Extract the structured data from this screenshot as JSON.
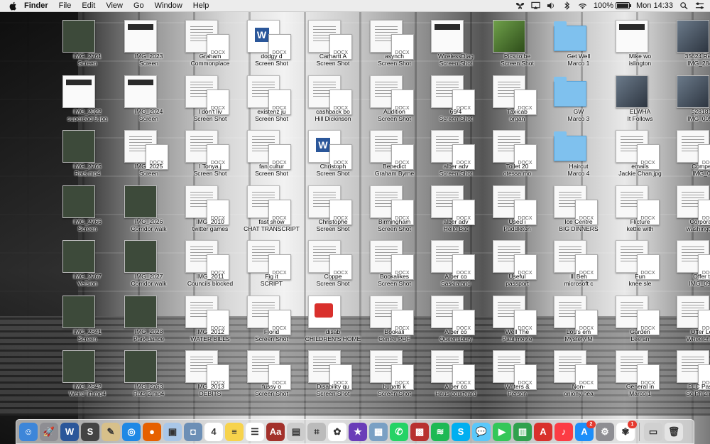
{
  "menubar": {
    "app_name": "Finder",
    "menus": [
      "File",
      "Edit",
      "View",
      "Go",
      "Window",
      "Help"
    ],
    "battery_percent": "100%",
    "battery_level": 1.0,
    "clock": "Mon 14:33"
  },
  "colors": {
    "menubar_bg": "#ececec",
    "folder_blue": "#7fc1ee",
    "word_blue": "#2b579a",
    "badge_red": "#e53b30"
  },
  "desktop": {
    "docx_tag": "DOCX",
    "icons": [
      {
        "kind": "video",
        "lines": [
          "IMG_2761",
          "Screen"
        ]
      },
      {
        "kind": "screenshot",
        "lines": [
          "IMG_2023",
          "Screen"
        ]
      },
      {
        "kind": "doc",
        "lines": [
          "Graham",
          "Commonplace"
        ]
      },
      {
        "kind": "word",
        "lines": [
          "dodgy d",
          "Screen Shot"
        ]
      },
      {
        "kind": "doc",
        "lines": [
          "Carhartt A",
          "Screen Shot"
        ]
      },
      {
        "kind": "doc",
        "lines": [
          "asynch",
          "Screen Shot"
        ]
      },
      {
        "kind": "screenshot",
        "lines": [
          "WirelessDiag",
          "Screen Shot"
        ]
      },
      {
        "kind": "green",
        "lines": [
          "Pics to be",
          "Screen Shot"
        ]
      },
      {
        "kind": "folder",
        "lines": [
          "Get Well",
          "Marco 1"
        ]
      },
      {
        "kind": "screenshot",
        "lines": [
          "Mike wo",
          "islington"
        ]
      },
      {
        "kind": "photo",
        "lines": [
          "35624 RevV",
          "IMG_2843"
        ]
      },
      {
        "kind": "screenshot",
        "lines": [
          "IMG_2022",
          "superbad 5.jpg"
        ]
      },
      {
        "kind": "screenshot",
        "lines": [
          "IMG_2024",
          "Screen"
        ]
      },
      {
        "kind": "doc",
        "lines": [
          "I don't liv",
          "Screen Shot"
        ]
      },
      {
        "kind": "doc",
        "lines": [
          "existenz ju",
          "Screen Shot"
        ]
      },
      {
        "kind": "doc",
        "lines": [
          "cashback bo",
          "Hill Dickinson"
        ]
      },
      {
        "kind": "doc",
        "lines": [
          "Audition",
          "Screen Shot"
        ]
      },
      {
        "kind": "doc",
        "lines": [
          "69/4",
          "Screen Shot"
        ]
      },
      {
        "kind": "doc",
        "lines": [
          "Taxicab",
          "organ"
        ]
      },
      {
        "kind": "folder",
        "lines": [
          "GW",
          "Marco 3"
        ]
      },
      {
        "kind": "photo",
        "lines": [
          "ELWHA",
          "It Follows"
        ]
      },
      {
        "kind": "photo",
        "lines": [
          "528181",
          "IMG_0951"
        ]
      },
      {
        "kind": "video",
        "lines": [
          "IMG_2765",
          "Rats.mp4"
        ]
      },
      {
        "kind": "doc",
        "lines": [
          "IMG_2025",
          "Screen"
        ]
      },
      {
        "kind": "doc",
        "lines": [
          "I Tonya.j",
          "Screen Shot"
        ]
      },
      {
        "kind": "doc",
        "lines": [
          "fan cultur",
          "Screen Shot"
        ]
      },
      {
        "kind": "word",
        "lines": [
          "Christoph",
          "Screen Shot"
        ]
      },
      {
        "kind": "doc",
        "lines": [
          "Benedict",
          "Graham Byrne"
        ]
      },
      {
        "kind": "doc",
        "lines": [
          "alber adv",
          "Screen Shot"
        ]
      },
      {
        "kind": "doc",
        "lines": [
          "Toilet 20",
          "otessa mo"
        ]
      },
      {
        "kind": "folder",
        "lines": [
          "Haircut",
          "Marco 4"
        ]
      },
      {
        "kind": "doc",
        "lines": [
          "emails",
          "Jackie Chan.jpg"
        ]
      },
      {
        "kind": "doc",
        "lines": [
          "Compe",
          "IMG_0"
        ]
      },
      {
        "kind": "video",
        "lines": [
          "IMG_2766",
          "Screen"
        ]
      },
      {
        "kind": "video",
        "lines": [
          "IMG_2026",
          "Corridor walk"
        ]
      },
      {
        "kind": "doc",
        "lines": [
          "IMG_2010",
          "twitter games"
        ]
      },
      {
        "kind": "doc",
        "lines": [
          "fast show",
          "CHAT TRANSCRIPT"
        ]
      },
      {
        "kind": "doc",
        "lines": [
          "Christophe",
          "Screen Shot"
        ]
      },
      {
        "kind": "doc",
        "lines": [
          "Birmingham",
          "Screen Shot"
        ]
      },
      {
        "kind": "doc",
        "lines": [
          "alber adv",
          "Hello Bat"
        ]
      },
      {
        "kind": "doc",
        "lines": [
          "Used i",
          "Paddleton"
        ]
      },
      {
        "kind": "doc",
        "lines": [
          "Ice Centre",
          "BIG DINNERS"
        ]
      },
      {
        "kind": "doc",
        "lines": [
          "Flicture",
          "kettle with"
        ]
      },
      {
        "kind": "doc",
        "lines": [
          "Corporat",
          "washington"
        ]
      },
      {
        "kind": "video",
        "lines": [
          "IMG_2767",
          "Version"
        ]
      },
      {
        "kind": "video",
        "lines": [
          "IMG_2027",
          "Corridor walk"
        ]
      },
      {
        "kind": "doc",
        "lines": [
          "IMG_2011",
          "Councils blocked"
        ]
      },
      {
        "kind": "doc",
        "lines": [
          "Fig it",
          "SCRIPT"
        ]
      },
      {
        "kind": "doc",
        "lines": [
          "Coppe",
          "Screen Shot"
        ]
      },
      {
        "kind": "doc",
        "lines": [
          "Bookalikes",
          "Screen Shot"
        ]
      },
      {
        "kind": "doc",
        "lines": [
          "Alber co",
          "Saskia and"
        ]
      },
      {
        "kind": "doc",
        "lines": [
          "Useful",
          "passport"
        ]
      },
      {
        "kind": "doc",
        "lines": [
          "Ill Beh",
          "microsoft c"
        ]
      },
      {
        "kind": "doc",
        "lines": [
          "Fun",
          "knee sle"
        ]
      },
      {
        "kind": "doc",
        "lines": [
          "Offer t",
          "IMG_095"
        ]
      },
      {
        "kind": "video",
        "lines": [
          "IMG_2841",
          "Screen"
        ]
      },
      {
        "kind": "video",
        "lines": [
          "IMG_2028",
          "Park dance"
        ]
      },
      {
        "kind": "doc",
        "lines": [
          "IMG_2012",
          "WATER BILLS"
        ]
      },
      {
        "kind": "doc",
        "lines": [
          "Florid",
          "Screen Shot"
        ]
      },
      {
        "kind": "pdf",
        "lines": [
          "disab",
          "CHILDREN'S HOME"
        ]
      },
      {
        "kind": "doc",
        "lines": [
          "Bookali",
          "Centre PDF"
        ]
      },
      {
        "kind": "doc",
        "lines": [
          "Alber co",
          "Queensbury"
        ]
      },
      {
        "kind": "doc",
        "lines": [
          "Well The",
          "Paul movie"
        ]
      },
      {
        "kind": "doc",
        "lines": [
          "Lou's em",
          "Mystery M"
        ]
      },
      {
        "kind": "doc",
        "lines": [
          "Garden",
          "Lee an"
        ]
      },
      {
        "kind": "doc",
        "lines": [
          "Offer Le",
          "Wheelchair"
        ]
      },
      {
        "kind": "video",
        "lines": [
          "IMG_2842",
          "Weird lift.mp4"
        ]
      },
      {
        "kind": "video",
        "lines": [
          "IMG_2763",
          "Rats 2.mp4"
        ]
      },
      {
        "kind": "doc",
        "lines": [
          "IMG_2013",
          "DEBITS"
        ]
      },
      {
        "kind": "doc",
        "lines": [
          "fussy o",
          "Screen Shot"
        ]
      },
      {
        "kind": "doc",
        "lines": [
          "Disability qu",
          "Screen Shot"
        ]
      },
      {
        "kind": "doc",
        "lines": [
          "bugatti k",
          "Screen Shot"
        ]
      },
      {
        "kind": "doc",
        "lines": [
          "Alber co",
          "Haus courtyard"
        ]
      },
      {
        "kind": "doc",
        "lines": [
          "Writers &",
          "Person"
        ]
      },
      {
        "kind": "doc",
        "lines": [
          "Non-",
          "oniony hea"
        ]
      },
      {
        "kind": "doc",
        "lines": [
          "General in",
          "Marco 1"
        ]
      },
      {
        "kind": "doc",
        "lines": [
          "PLC Pass",
          "Sc Ph 2.jpg"
        ]
      }
    ]
  },
  "dock": {
    "apps": [
      {
        "name": "Finder",
        "icon": "finder-icon",
        "bg": "#3d86d9",
        "glyph": "☺"
      },
      {
        "name": "Launchpad",
        "icon": "rocket-icon",
        "bg": "#8e8e93",
        "glyph": "🚀"
      },
      {
        "name": "Microsoft Word",
        "icon": "word-icon",
        "bg": "#2b579a",
        "glyph": "W"
      },
      {
        "name": "Scrivener",
        "icon": "scrivener-icon",
        "bg": "#444",
        "glyph": "S"
      },
      {
        "name": "TextEdit",
        "icon": "textedit-icon",
        "bg": "#d7c08a",
        "glyph": "✎"
      },
      {
        "name": "Safari",
        "icon": "safari-icon",
        "bg": "#1e88e5",
        "glyph": "◎"
      },
      {
        "name": "Firefox",
        "icon": "firefox-icon",
        "bg": "#e66000",
        "glyph": "●"
      },
      {
        "name": "Preview",
        "icon": "preview-icon",
        "bg": "#a9c7e8",
        "glyph": "▣"
      },
      {
        "name": "Image Capture",
        "icon": "camera-icon",
        "bg": "#6c8fb6",
        "glyph": "◘"
      },
      {
        "name": "Calendar",
        "icon": "calendar-icon",
        "bg": "#ffffff",
        "glyph": "4"
      },
      {
        "name": "Notes",
        "icon": "notes-icon",
        "bg": "#f7d34c",
        "glyph": "≡"
      },
      {
        "name": "Reminders",
        "icon": "reminders-icon",
        "bg": "#ffffff",
        "glyph": "☰"
      },
      {
        "name": "Dictionary",
        "icon": "dictionary-icon",
        "bg": "#a3312b",
        "glyph": "Aa"
      },
      {
        "name": "Quick Look",
        "icon": "image-icon",
        "bg": "#cccccc",
        "glyph": "▤"
      },
      {
        "name": "Screenshot",
        "icon": "screenshot-icon",
        "bg": "#bbbbbb",
        "glyph": "⌗"
      },
      {
        "name": "Photos",
        "icon": "photos-icon",
        "bg": "#ffffff",
        "glyph": "✿"
      },
      {
        "name": "iMovie",
        "icon": "star-icon",
        "bg": "#6a3db8",
        "glyph": "★"
      },
      {
        "name": "Preview Images",
        "icon": "gallery-icon",
        "bg": "#7aa0c4",
        "glyph": "▦"
      },
      {
        "name": "WhatsApp",
        "icon": "whatsapp-icon",
        "bg": "#25d366",
        "glyph": "✆"
      },
      {
        "name": "Photo Booth",
        "icon": "photobooth-icon",
        "bg": "#b8312f",
        "glyph": "▩"
      },
      {
        "name": "Spotify",
        "icon": "spotify-icon",
        "bg": "#1db954",
        "glyph": "≋"
      },
      {
        "name": "Skype",
        "icon": "skype-icon",
        "bg": "#00aff0",
        "glyph": "S"
      },
      {
        "name": "Messages",
        "icon": "messages-icon",
        "bg": "#5ac8fa",
        "glyph": "💬"
      },
      {
        "name": "FaceTime",
        "icon": "facetime-icon",
        "bg": "#34c759",
        "glyph": "▶"
      },
      {
        "name": "Numbers",
        "icon": "numbers-icon",
        "bg": "#30a14e",
        "glyph": "▥"
      },
      {
        "name": "Acrobat",
        "icon": "acrobat-icon",
        "bg": "#d9302c",
        "glyph": "A"
      },
      {
        "name": "Music",
        "icon": "music-icon",
        "bg": "#fc3c44",
        "glyph": "♪"
      },
      {
        "name": "App Store",
        "icon": "appstore-icon",
        "bg": "#1c8ef9",
        "glyph": "A",
        "badge": "2"
      },
      {
        "name": "System Preferences",
        "icon": "gear-icon",
        "bg": "#8e8e93",
        "glyph": "⚙"
      },
      {
        "name": "Photos Library",
        "icon": "flower-icon",
        "bg": "#ffffff",
        "glyph": "✾",
        "badge": "1"
      },
      {
        "name": "Downloads",
        "icon": "downloads-icon",
        "bg": "#d0d0d0",
        "glyph": "▭"
      },
      {
        "name": "Trash",
        "icon": "trash-icon",
        "bg": "#e4e4e4",
        "glyph": "🗑"
      }
    ]
  }
}
